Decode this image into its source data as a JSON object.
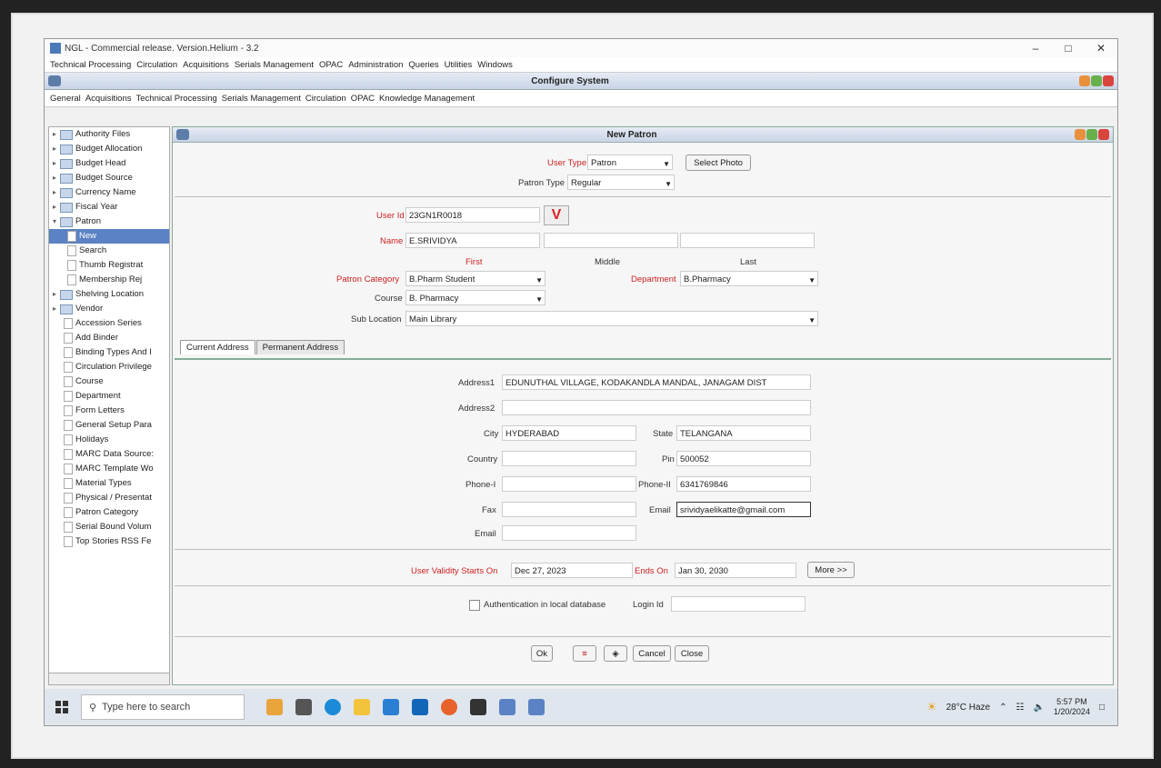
{
  "window": {
    "title": "NGL - Commercial release. Version.Helium - 3.2",
    "controls": [
      "–",
      "□",
      "✕"
    ]
  },
  "menubar": [
    "Technical Processing",
    "Circulation",
    "Acquisitions",
    "Serials Management",
    "OPAC",
    "Administration",
    "Queries",
    "Utilities",
    "Windows"
  ],
  "configure": {
    "title": "Configure System",
    "menu": [
      "General",
      "Acquisitions",
      "Technical Processing",
      "Serials Management",
      "Circulation",
      "OPAC",
      "Knowledge Management"
    ]
  },
  "tree": {
    "folders_top": [
      "Authority Files",
      "Budget Allocation",
      "Budget Head",
      "Budget Source",
      "Currency Name",
      "Fiscal Year"
    ],
    "patron": "Patron",
    "patron_children": [
      "New",
      "Search",
      "Thumb Registrat",
      "Membership Rej"
    ],
    "folders_mid": [
      "Shelving Location",
      "Vendor"
    ],
    "leaves": [
      "Accession Series",
      "Add Binder",
      "Binding Types And I",
      "Circulation Privilege",
      "Course",
      "Department",
      "Form Letters",
      "General Setup Para",
      "Holidays",
      "MARC Data Source:",
      "MARC Template Wo",
      "Material Types",
      "Physical / Presentat",
      "Patron Category",
      "Serial Bound Volum",
      "Top Stories RSS Fe"
    ]
  },
  "form": {
    "title": "New Patron",
    "user_type_label": "User Type",
    "user_type": "Patron",
    "select_photo": "Select Photo",
    "patron_type_label": "Patron Type",
    "patron_type": "Regular",
    "user_id_label": "User Id",
    "user_id": "23GN1R0018",
    "v_mark": "V",
    "name_label": "Name",
    "name_first": "E.SRIVIDYA",
    "name_middle": "",
    "name_last": "",
    "first_caption": "First",
    "middle_caption": "Middle",
    "last_caption": "Last",
    "patron_category_label": "Patron Category",
    "patron_category": "B.Pharm Student",
    "department_label": "Department",
    "department": "B.Pharmacy",
    "course_label": "Course",
    "course": "B. Pharmacy",
    "sub_location_label": "Sub Location",
    "sub_location": "Main Library",
    "tabs": [
      "Current Address",
      "Permanent Address"
    ],
    "address1_label": "Address1",
    "address1": "EDUNUTHAL VILLAGE, KODAKANDLA MANDAL, JANAGAM DIST",
    "address2_label": "Address2",
    "address2": "",
    "city_label": "City",
    "city": "HYDERABAD",
    "state_label": "State",
    "state": "TELANGANA",
    "country_label": "Country",
    "country": "",
    "pin_label": "Pin",
    "pin": "500052",
    "phone_label": "Phone-I",
    "phone": "",
    "phone2_label": "Phone-II",
    "phone2": "6341769846",
    "fax_label": "Fax",
    "fax": "",
    "email_label": "Email",
    "email": "srividyaelikatte@gmail.com",
    "email2_label": "Email",
    "email2": "",
    "validity_label": "User Validity Starts On",
    "validity_start": "Dec 27, 2023",
    "ends_label": "Ends On",
    "validity_end": "Jan 30, 2030",
    "more": "More >>",
    "auth_label": "Authentication in local database",
    "login_label": "Login Id",
    "login": "",
    "buttons": {
      "ok": "Ok",
      "cancel": "Cancel",
      "close": "Close"
    }
  },
  "taskbar": {
    "search_placeholder": "Type here to search",
    "weather": "28°C Haze",
    "time": "5:57 PM",
    "date": "1/20/2024"
  }
}
